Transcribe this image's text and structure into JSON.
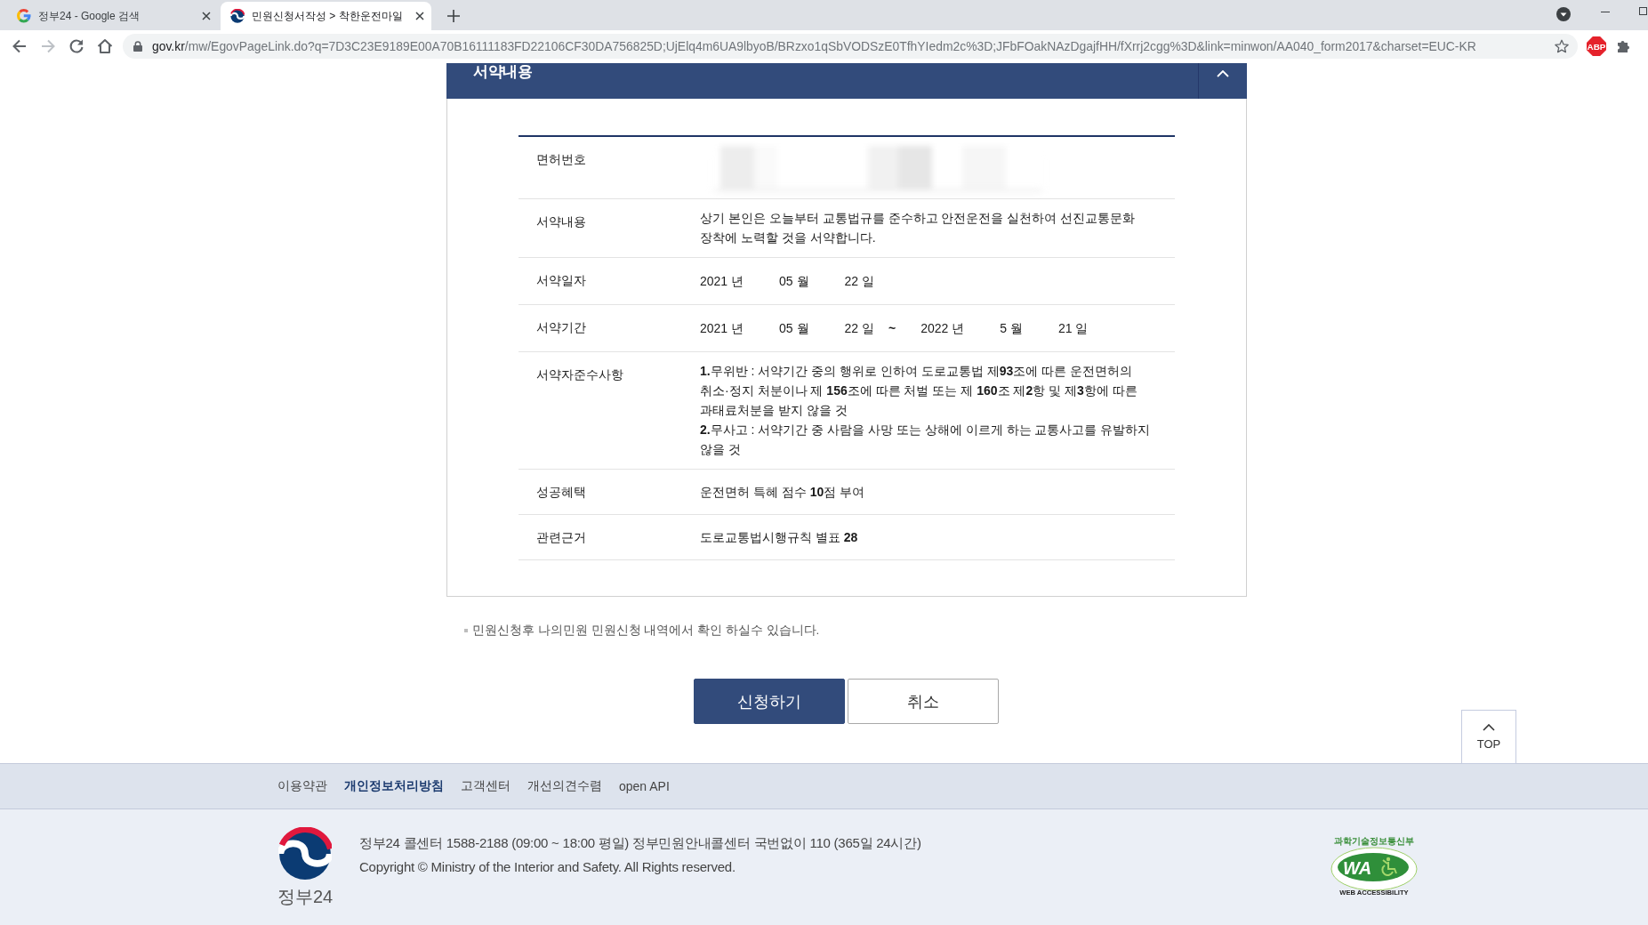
{
  "browser": {
    "tabs": [
      {
        "title": "정부24 - Google 검색",
        "selected": false
      },
      {
        "title": "민원신청서작성 > 착한운전마일",
        "selected": true
      }
    ],
    "address": {
      "host": "gov.kr",
      "path": "/mw/EgovPageLink.do?q=7D3C23E9189E00A70B16111183FD22106CF30DA756825D;UjElq4m6UA9lbyoB/BRzxo1qSbVODSzE0TfhYIedm2c%3D;JFbFOakNAzDgajfHH/fXrrj2cgg%3D&link=minwon/AA040_form2017&charset=EUC-KR"
    },
    "extension_badge": "ABP"
  },
  "section": {
    "title": "서약내용",
    "expanded": true,
    "rows": [
      {
        "label": "면허번호",
        "kind": "blurred"
      },
      {
        "label": "서약내용",
        "kind": "text",
        "value": "상기 본인은 오늘부터 교통법규를 준수하고 안전운전을 실천하여 선진교통문화 장착에 노력할 것을 서약합니다."
      },
      {
        "label": "서약일자",
        "kind": "date",
        "parts": [
          "2021 년",
          "05 월",
          "22 일"
        ]
      },
      {
        "label": "서약기간",
        "kind": "period",
        "start": [
          "2021 년",
          "05 월",
          "22 일"
        ],
        "separator": "~",
        "end": [
          "2022 년",
          "5 월",
          "21 일"
        ]
      },
      {
        "label": "서약자준수사항",
        "kind": "list",
        "items": [
          "**1.**무위반 : 서약기간 중의 행위로 인하여 도로교통법 제**93**조에 따른 운전면허의 취소·정지 처분이나 제 **156**조에 따른 처벌 또는 제 **160**조 제**2**항 및 제**3**항에 따른 과태료처분을 받지 않을 것",
          "**2.**무사고 : 서약기간 중 사람을 사망 또는 상해에 이르게 하는 교통사고를 유발하지 않을 것"
        ]
      },
      {
        "label": "성공혜택",
        "kind": "text",
        "value": "운전면허 특혜 점수 **10**점 부여"
      },
      {
        "label": "관련근거",
        "kind": "text",
        "value": "도로교통법시행규칙 별표 **28**"
      }
    ]
  },
  "notice": "민원신청후 나의민원 민원신청 내역에서 확인 하실수 있습니다.",
  "buttons": [
    {
      "label": "신청하기",
      "kind": "primary"
    },
    {
      "label": "취소",
      "kind": "secondary"
    }
  ],
  "top_button": {
    "label": "TOP"
  },
  "footer": {
    "links": [
      {
        "label": "이용약관",
        "emphasized": false
      },
      {
        "label": "개인정보처리방침",
        "emphasized": true
      },
      {
        "label": "고객센터",
        "emphasized": false
      },
      {
        "label": "개선의견수렴",
        "emphasized": false
      },
      {
        "label": "open API",
        "emphasized": false
      }
    ],
    "logo_text": "정부24",
    "contact": "정부24 콜센터 1588-2188 (09:00 ~ 18:00 평일) 정부민원안내콜센터 국번없이 110 (365일 24시간)",
    "copyright": "Copyright © Ministry of the Interior and Safety. All Rights reserved.",
    "badge": {
      "ministry": "과학기술정보통신부",
      "mark": "WA",
      "caption": "WEB ACCESSIBILITY"
    }
  }
}
